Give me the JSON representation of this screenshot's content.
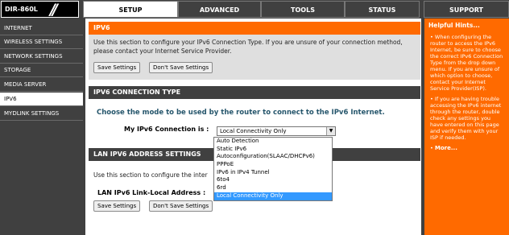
{
  "header": {
    "model": "DIR-860L",
    "tabs": [
      {
        "label": "SETUP",
        "active": true
      },
      {
        "label": "ADVANCED"
      },
      {
        "label": "TOOLS"
      },
      {
        "label": "STATUS"
      },
      {
        "label": "SUPPORT"
      }
    ]
  },
  "sidebar": {
    "items": [
      {
        "label": "INTERNET"
      },
      {
        "label": "WIRELESS SETTINGS"
      },
      {
        "label": "NETWORK SETTINGS"
      },
      {
        "label": "STORAGE"
      },
      {
        "label": "MEDIA SERVER"
      },
      {
        "label": "IPV6",
        "active": true
      },
      {
        "label": "MYDLINK SETTINGS"
      }
    ]
  },
  "ipv6": {
    "title": "IPV6",
    "description": "Use this section to configure your IPv6 Connection Type. If you are unsure of your connection method, please contact your Internet Service Provider.",
    "save_label": "Save Settings",
    "dont_save_label": "Don't Save Settings"
  },
  "connection_type": {
    "title": "IPV6 CONNECTION TYPE",
    "question": "Choose the mode to be used by the router to connect to the IPv6 Internet.",
    "field_label": "My IPv6 Connection is :",
    "selected": "Local Connectivity Only",
    "options": [
      "Auto Detection",
      "Static IPv6",
      "Autoconfiguration(SLAAC/DHCPv6)",
      "PPPoE",
      "IPv6 in IPv4 Tunnel",
      "6to4",
      "6rd",
      "Local Connectivity Only"
    ]
  },
  "lan": {
    "title": "LAN IPV6 ADDRESS SETTINGS",
    "description": "Use this section to configure the inter",
    "field_label": "LAN IPv6 Link-Local Address :"
  },
  "footer": {
    "save_label": "Save Settings",
    "dont_save_label": "Don't Save Settings"
  },
  "hints": {
    "title": "Helpful Hints...",
    "items": [
      "When configuring the router to access the IPv6 Internet, be sure to choose the correct IPv6 Connection Type from the drop down menu. If you are unsure of which option to choose, contact your Internet Service Provider(ISP).",
      "If you are having trouble accessing the IPv6 internet through the router, double check any settings you have entered on this page and verify them with your ISP if needed."
    ],
    "more": "More..."
  },
  "colors": {
    "accent_orange": "#ff6a00",
    "nav_dark": "#404040",
    "question_blue": "#26566c",
    "selection_blue": "#3399ff"
  }
}
